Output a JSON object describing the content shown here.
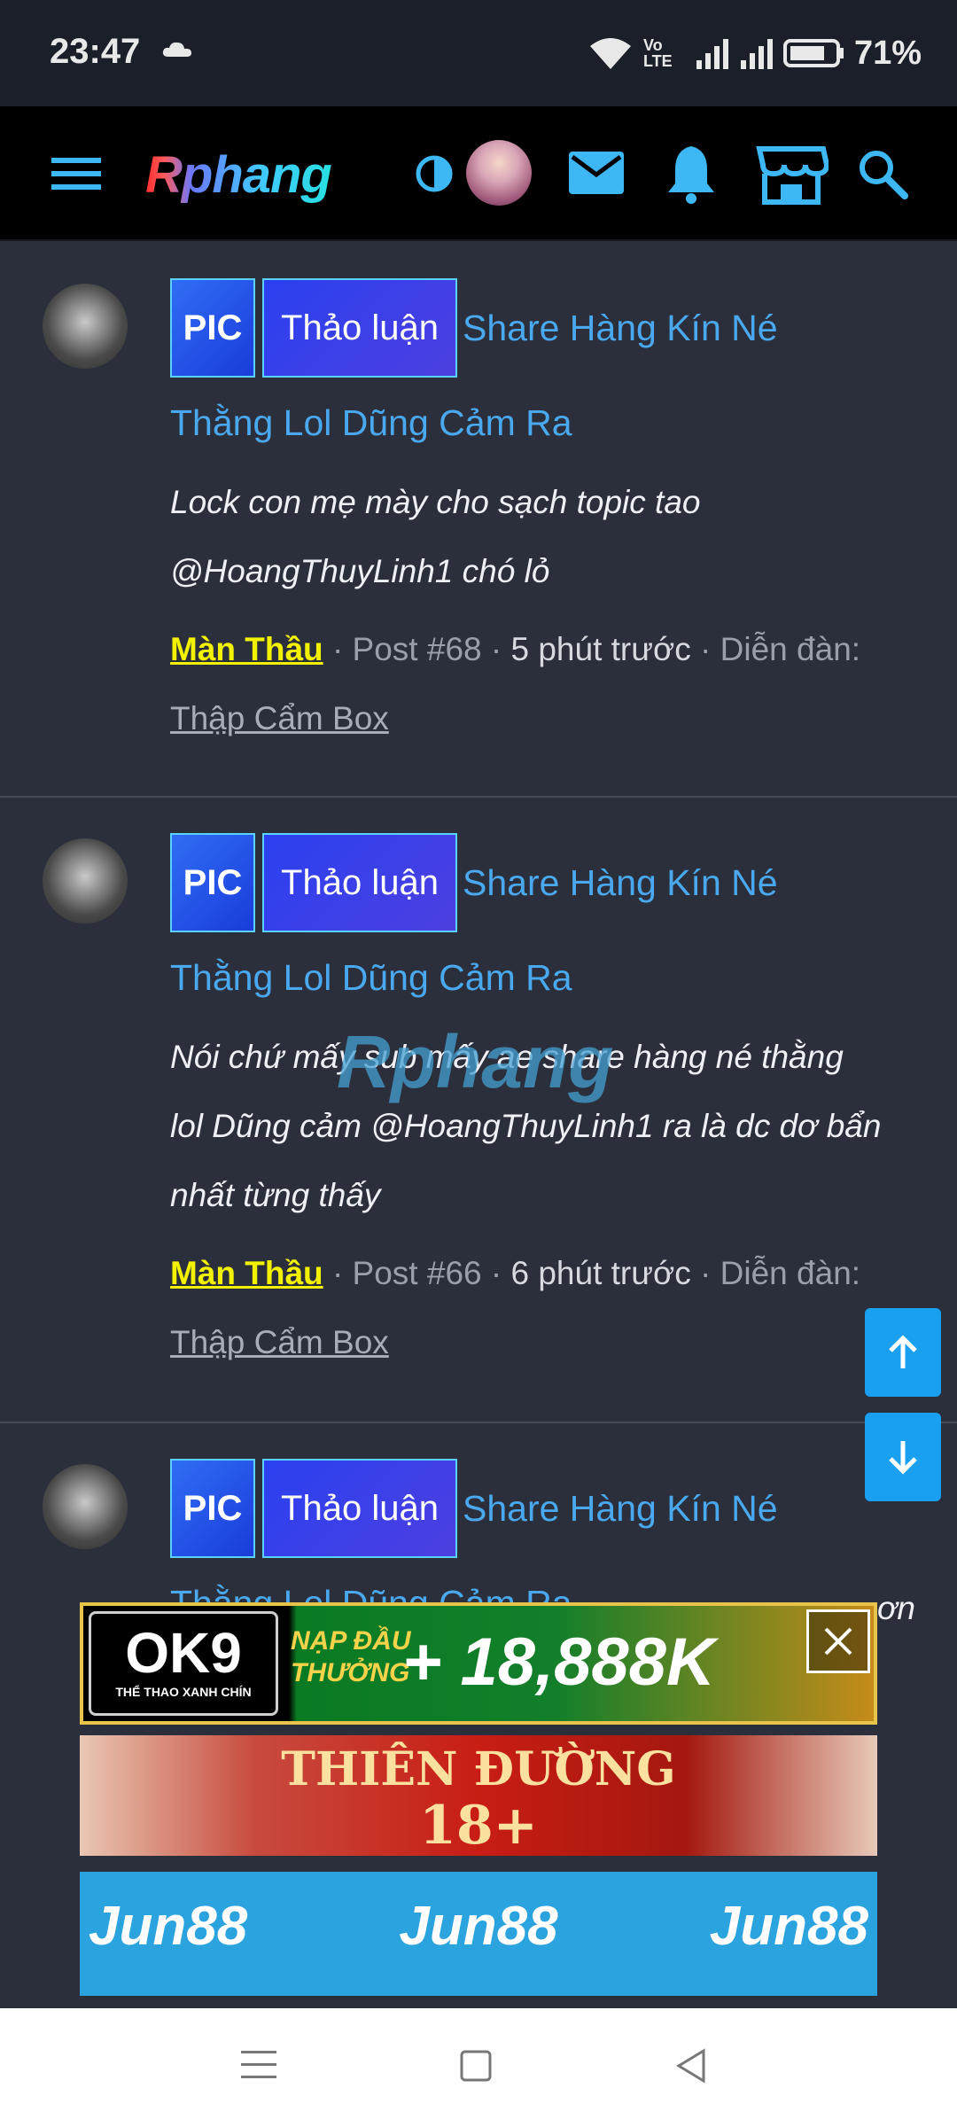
{
  "status": {
    "time": "23:47",
    "volte": "Vo LTE",
    "battery": "71%",
    "icons": [
      "cloud-icon",
      "wifi-icon",
      "signal-icon",
      "battery-icon"
    ]
  },
  "nav": {
    "logo": "Rphang",
    "icons": [
      "menu-icon",
      "theme-toggle-icon",
      "avatar",
      "mail-icon",
      "bell-icon",
      "store-icon",
      "search-icon"
    ]
  },
  "posts": [
    {
      "badge1": "PIC",
      "badge2": "Thảo luận",
      "title_a": "Share Hàng Kín Né",
      "title_b": "Thằng Lol Dũng Cảm Ra",
      "snippet_lines": [
        "Lock con mẹ mày cho sạch topic tao",
        "@HoangThuyLinh1 chó lỏ"
      ],
      "author": "Màn Thầu",
      "post_no": " · Post #68 · ",
      "time": "5 phút trước",
      "forum_label": " · Diễn đàn:",
      "forum": "Thập Cẩm Box"
    },
    {
      "badge1": "PIC",
      "badge2": "Thảo luận",
      "title_a": "Share Hàng Kín Né",
      "title_b": "Thằng Lol Dũng Cảm Ra",
      "snippet_lines": [
        "Nói chứ mấy sub mấy ae share hàng né thằng",
        "lol Dũng cảm @HoangThuyLinh1 ra là dc dơ bẩn",
        "nhất từng thấy"
      ],
      "author": "Màn Thầu",
      "post_no": " · Post #66 · ",
      "time": "6 phút trước",
      "forum_label": " · Diễn đàn:",
      "forum": "Thập Cẩm Box"
    },
    {
      "badge1": "PIC",
      "badge2": "Thảo luận",
      "title_a": "Share Hàng Kín Né",
      "title_b": "Thằng Lol Dũng Cảm Ra",
      "snippet_tail": "ơn"
    }
  ],
  "watermark": "Rphang",
  "ads": {
    "ok9_brand": "OK9",
    "ok9_sub": "THỂ THAO XANH CHÍN",
    "ok9_line1": "NẠP ĐẦU",
    "ok9_line2": "THƯỞNG",
    "ok9_amount": "+ 18,888K",
    "thien_line1": "THIÊN ĐƯỜNG",
    "thien_line2": "18+",
    "jun": "Jun88"
  },
  "colors": {
    "accent": "#4aa8ee",
    "author": "#f2f200",
    "fab": "#1aa0f0"
  }
}
